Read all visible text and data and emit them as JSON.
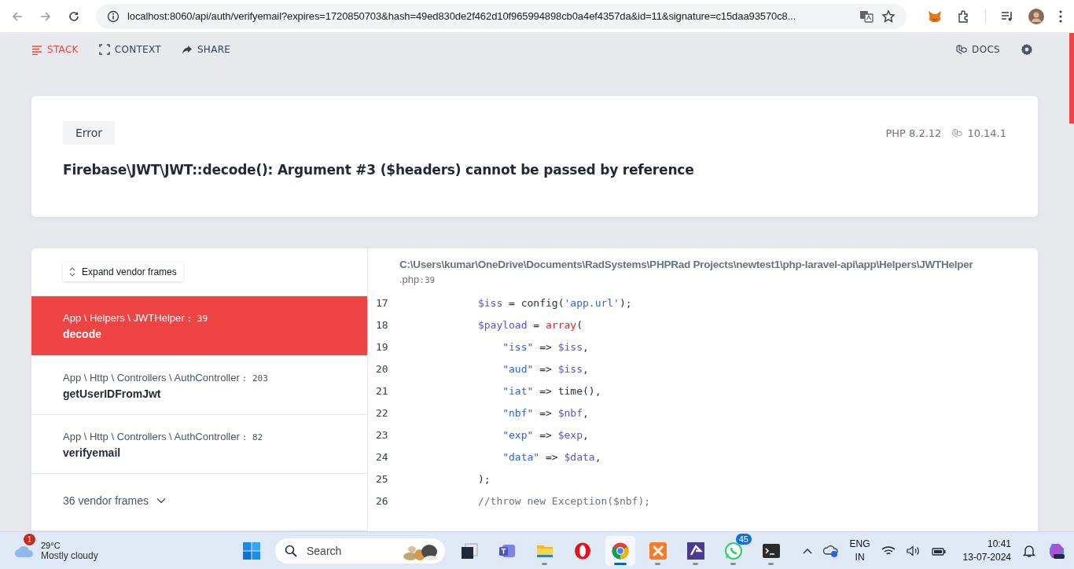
{
  "browser": {
    "url": "localhost:8060/api/auth/verifyemail?expires=1720850703&hash=49ed830de2f462d10f965994898cb0a4ef4357da&id=11&signature=c15daa93570c8..."
  },
  "nav": {
    "tabs": [
      {
        "label": "STACK",
        "selected": true
      },
      {
        "label": "CONTEXT",
        "selected": false
      },
      {
        "label": "SHARE",
        "selected": false
      }
    ],
    "docs": "DOCS"
  },
  "error": {
    "badge": "Error",
    "php_version": "PHP 8.2.12",
    "laravel_version": "10.14.1",
    "message": "Firebase\\JWT\\JWT::decode(): Argument #3 ($headers) cannot be passed by reference"
  },
  "stack": {
    "expand_button": "Expand vendor frames",
    "frames": [
      {
        "kind": "frame",
        "class": "App \\ Helpers \\ JWTHelper",
        "line": ": 39",
        "method": "decode",
        "selected": true
      },
      {
        "kind": "frame",
        "class": "App \\ Http \\ Controllers \\ AuthController",
        "line": ": 203",
        "method": "getUserIDFromJwt",
        "selected": false
      },
      {
        "kind": "frame",
        "class": "App \\ Http \\ Controllers \\ AuthController",
        "line": ": 82",
        "method": "verifyemail",
        "selected": false
      },
      {
        "kind": "vendor_group",
        "label": "36 vendor frames",
        "selected": false
      }
    ],
    "file_path": "C:\\Users\\kumar\\OneDrive\\Documents\\RadSystems\\PHPRad Projects\\newtest1\\php-laravel-api\\app\\Helpers\\JWTHelper",
    "file_ext": ".php",
    "file_line": ":39",
    "code": [
      {
        "number": "17",
        "tokens": [
          {
            "kind": "var",
            "text": "$iss"
          },
          {
            "kind": "plain",
            "text": " = config("
          },
          {
            "kind": "str",
            "text": "'app.url'"
          },
          {
            "kind": "plain",
            "text": ");"
          }
        ]
      },
      {
        "number": "18",
        "tokens": [
          {
            "kind": "var",
            "text": "$payload"
          },
          {
            "kind": "plain",
            "text": " = "
          },
          {
            "kind": "keyword",
            "text": "array"
          },
          {
            "kind": "plain",
            "text": "("
          }
        ],
        "children": [
          {
            "number": "19",
            "tokens": [
              {
                "kind": "str",
                "text": "\"iss\""
              },
              {
                "kind": "plain",
                "text": " => "
              },
              {
                "kind": "var",
                "text": "$iss"
              },
              {
                "kind": "plain",
                "text": ","
              }
            ]
          },
          {
            "number": "20",
            "tokens": [
              {
                "kind": "str",
                "text": "\"aud\""
              },
              {
                "kind": "plain",
                "text": " => "
              },
              {
                "kind": "var",
                "text": "$iss"
              },
              {
                "kind": "plain",
                "text": ","
              }
            ]
          },
          {
            "number": "21",
            "tokens": [
              {
                "kind": "str",
                "text": "\"iat\""
              },
              {
                "kind": "plain",
                "text": " => time(),"
              }
            ]
          },
          {
            "number": "22",
            "tokens": [
              {
                "kind": "str",
                "text": "\"nbf\""
              },
              {
                "kind": "plain",
                "text": " => "
              },
              {
                "kind": "var",
                "text": "$nbf"
              },
              {
                "kind": "plain",
                "text": ","
              }
            ]
          },
          {
            "number": "23",
            "tokens": [
              {
                "kind": "str",
                "text": "\"exp\""
              },
              {
                "kind": "plain",
                "text": " => "
              },
              {
                "kind": "var",
                "text": "$exp"
              },
              {
                "kind": "plain",
                "text": ","
              }
            ]
          },
          {
            "number": "24",
            "tokens": [
              {
                "kind": "str",
                "text": "\"data\""
              },
              {
                "kind": "plain",
                "text": " => "
              },
              {
                "kind": "var",
                "text": "$data"
              },
              {
                "kind": "plain",
                "text": ","
              }
            ]
          }
        ]
      },
      {
        "number": "25",
        "tokens": [
          {
            "kind": "plain",
            "text": ");"
          }
        ]
      },
      {
        "number": "26",
        "tokens": [
          {
            "kind": "comment",
            "text": "//throw new Exception($nbf);"
          }
        ]
      }
    ]
  },
  "taskbar": {
    "weather": {
      "temperature": "29°C",
      "condition": "Mostly cloudy",
      "badge": "1"
    },
    "search": {
      "placeholder": "Search"
    },
    "apps": [
      {
        "kind": "taskview",
        "selected": false,
        "running": false
      },
      {
        "kind": "teams",
        "selected": false,
        "running": false
      },
      {
        "kind": "files",
        "selected": false,
        "running": true
      },
      {
        "kind": "opera",
        "selected": false,
        "running": false
      },
      {
        "kind": "chrome",
        "selected": true,
        "running": true
      },
      {
        "kind": "xampp",
        "selected": false,
        "running": true
      },
      {
        "kind": "phprad",
        "selected": false,
        "running": true
      },
      {
        "kind": "whatsapp",
        "selected": false,
        "running": true,
        "badge": "45"
      },
      {
        "kind": "terminal",
        "selected": false,
        "running": true
      }
    ],
    "language": "ENG",
    "region": "IN",
    "time": "10:41",
    "date": "13-07-2024"
  }
}
